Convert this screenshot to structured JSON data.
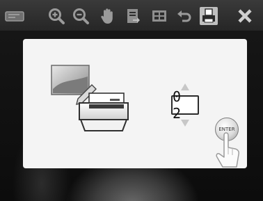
{
  "toolbar": {
    "buttons": [
      {
        "name": "slideshow-icon"
      },
      {
        "name": "zoom-in-icon"
      },
      {
        "name": "zoom-out-icon"
      },
      {
        "name": "hand-pan-icon"
      },
      {
        "name": "rotate-icon"
      },
      {
        "name": "index-view-icon"
      },
      {
        "name": "back-icon"
      },
      {
        "name": "print-icon"
      },
      {
        "name": "close-icon"
      }
    ]
  },
  "dialog": {
    "print_icon": "photo-printer-icon",
    "copies": "0 2",
    "enter_label": "ENTER",
    "touch_hint": "hand-pointer-icon"
  },
  "colors": {
    "toolbar_icon": "#9a9a9a",
    "close_icon": "#cfcfcf",
    "dialog_bg": "#f4f4f4"
  }
}
